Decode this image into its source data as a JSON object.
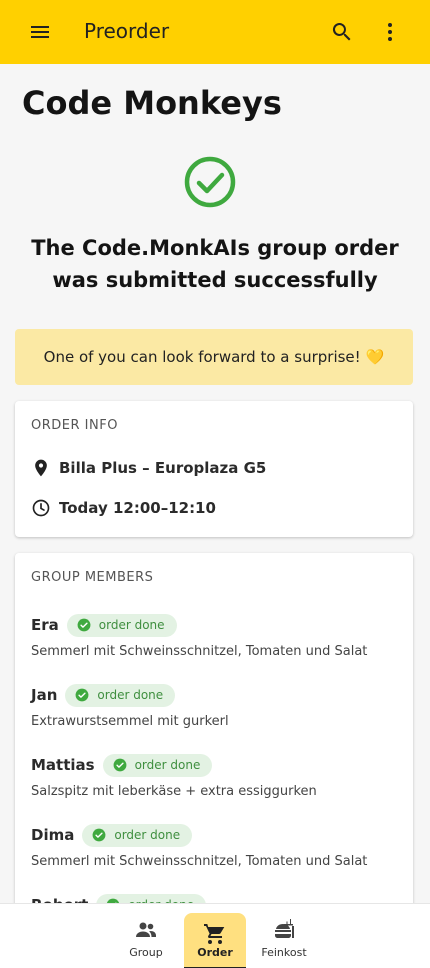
{
  "appbar": {
    "title": "Preorder"
  },
  "page": {
    "title": "Code Monkeys"
  },
  "success": {
    "message": "The Code.MonkAIs group order was submitted successfully"
  },
  "banner": {
    "text": "One of you can look forward to a surprise!",
    "emoji": "💛"
  },
  "order_info": {
    "label": "ORDER INFO",
    "location": "Billa Plus – Europlaza G5",
    "time": "Today 12:00–12:10"
  },
  "group_members": {
    "label": "GROUP MEMBERS",
    "members": [
      {
        "name": "Era",
        "status": "order done",
        "order": "Semmerl mit Schweinsschnitzel, Tomaten und Salat"
      },
      {
        "name": "Jan",
        "status": "order done",
        "order": "Extrawurstsemmel mit gurkerl"
      },
      {
        "name": "Mattias",
        "status": "order done",
        "order": "Salzspitz mit leberkäse + extra essiggurken"
      },
      {
        "name": "Dima",
        "status": "order done",
        "order": "Semmerl mit Schweinsschnitzel, Tomaten und Salat"
      },
      {
        "name": "Robert",
        "status": "order done",
        "order": ""
      }
    ]
  },
  "bottom_nav": {
    "items": [
      {
        "label": "Group",
        "icon": "group-icon"
      },
      {
        "label": "Order",
        "icon": "cart-icon"
      },
      {
        "label": "Feinkost",
        "icon": "food-icon"
      }
    ],
    "active": "Order"
  },
  "colors": {
    "primary": "#ffd000",
    "success": "#3fa93f",
    "banner": "#fbe9a4"
  }
}
